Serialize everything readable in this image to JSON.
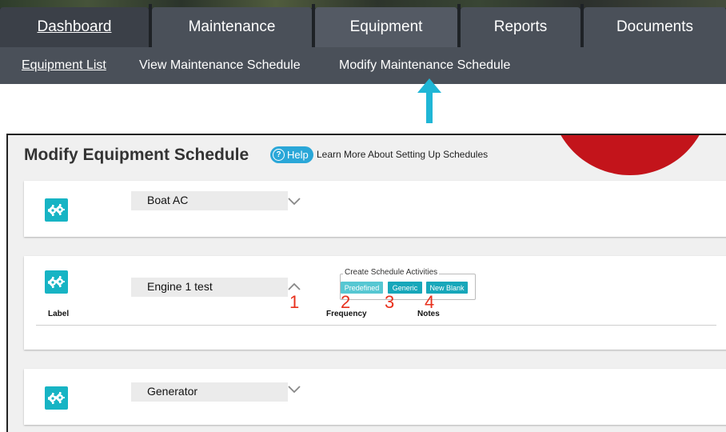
{
  "nav": {
    "tabs": [
      {
        "label": "Dashboard"
      },
      {
        "label": "Maintenance"
      },
      {
        "label": "Equipment"
      },
      {
        "label": "Reports"
      },
      {
        "label": "Documents"
      }
    ],
    "active_tab": "Equipment",
    "subtabs": [
      {
        "label": "Equipment List"
      },
      {
        "label": "View Maintenance Schedule"
      },
      {
        "label": "Modify Maintenance Schedule"
      }
    ]
  },
  "page": {
    "title": "Modify Equipment Schedule",
    "help_label": "Help",
    "help_icon": "?",
    "help_link": "Learn More About Setting Up Schedules"
  },
  "equipment": [
    {
      "name": "Boat AC",
      "expanded": false
    },
    {
      "name": "Engine 1 test",
      "expanded": true,
      "activities_legend": "Create Schedule Activities",
      "buttons": [
        "Predefined",
        "Generic",
        "New Blank"
      ],
      "columns": [
        "Label",
        "Frequency",
        "Notes"
      ]
    },
    {
      "name": "Generator",
      "expanded": false
    }
  ],
  "annotations": [
    "1",
    "2",
    "3",
    "4"
  ],
  "colors": {
    "nav_bg": "#4a5059",
    "accent": "#17b4c4",
    "help": "#2aa7d8",
    "annotation": "#e8301c",
    "arrow": "#1fb6d6"
  },
  "icons": {
    "equipment": "gears-icon",
    "collapse": "chevron-up-icon",
    "expand": "chevron-down-icon"
  }
}
